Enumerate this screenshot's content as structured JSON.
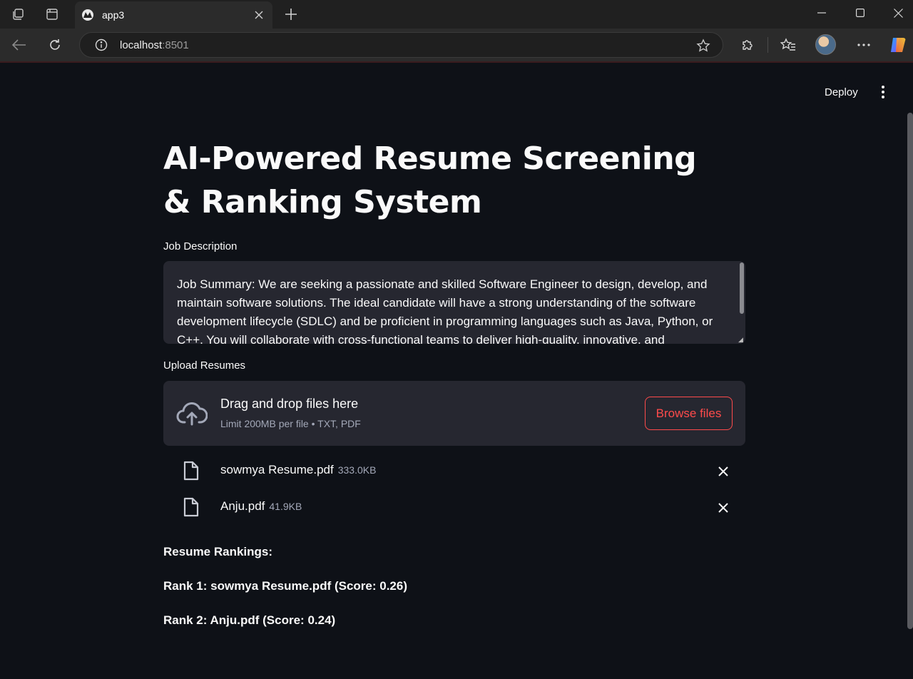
{
  "browser": {
    "tab_title": "app3",
    "address_host": "localhost",
    "address_port": ":8501"
  },
  "header": {
    "deploy_label": "Deploy"
  },
  "main": {
    "title": "AI-Powered Resume Screening & Ranking System",
    "job_description_label": "Job Description",
    "job_description_text": "Job Summary: We are seeking a passionate and skilled Software Engineer to design, develop, and maintain software solutions. The ideal candidate will have a strong understanding of the software development lifecycle (SDLC) and be proficient in programming languages such as Java, Python, or C++. You will collaborate with cross-functional teams to deliver high-quality, innovative, and",
    "upload_label": "Upload Resumes",
    "dropzone_title": "Drag and drop files here",
    "dropzone_sub": "Limit 200MB per file • TXT, PDF",
    "browse_label": "Browse files",
    "files": [
      {
        "name": "sowmya Resume.pdf",
        "size": "333.0KB"
      },
      {
        "name": "Anju.pdf",
        "size": "41.9KB"
      }
    ],
    "rankings_heading": "Resume Rankings:",
    "rankings": [
      "Rank 1: sowmya Resume.pdf (Score: 0.26)",
      "Rank 2: Anju.pdf (Score: 0.24)"
    ]
  },
  "icons": {
    "workspaces": "workspaces-icon",
    "tab_actions": "tab-actions-icon",
    "back": "back-arrow-icon",
    "refresh": "refresh-icon",
    "info": "info-icon",
    "favorite": "star-icon",
    "extensions": "puzzle-icon",
    "favorites": "favorites-icon",
    "more": "more-icon",
    "upload": "cloud-upload-icon",
    "file": "file-icon",
    "close": "close-icon"
  },
  "colors": {
    "background": "#0e1117",
    "widget": "#262730",
    "accent": "#ff4b4b"
  }
}
